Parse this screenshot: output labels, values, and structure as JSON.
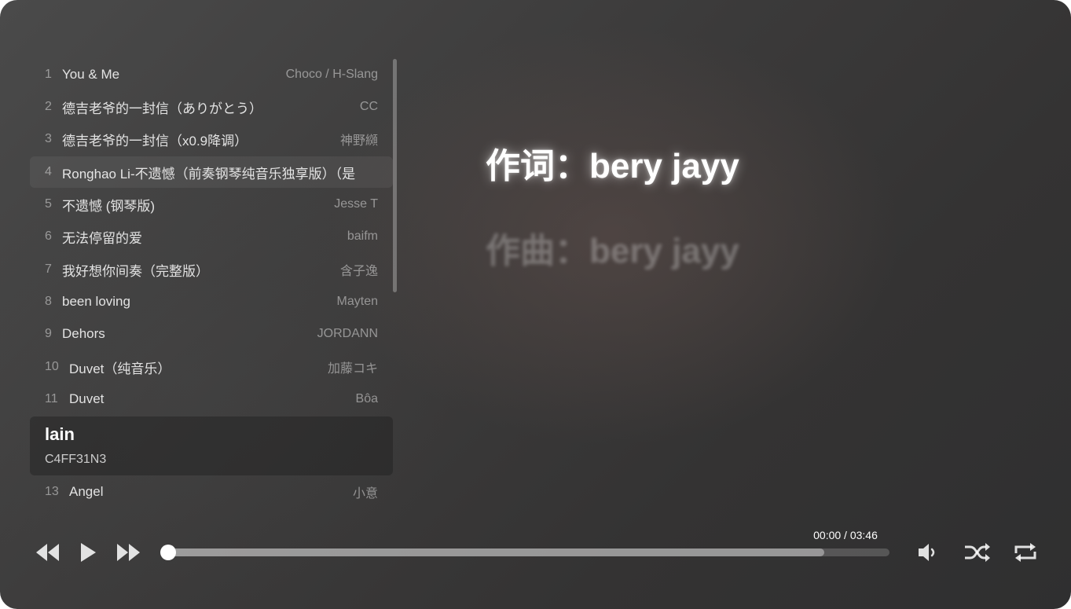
{
  "playlist": {
    "tracks": [
      {
        "index": "1",
        "title": "You & Me",
        "artist": "Choco / H-Slang"
      },
      {
        "index": "2",
        "title": "德吉老爷的一封信（ありがとう）",
        "artist": "CC"
      },
      {
        "index": "3",
        "title": "德吉老爷的一封信（x0.9降调）",
        "artist": "神野纐"
      },
      {
        "index": "4",
        "title": "Ronghao Li-不遗憾（前奏钢琴纯音乐独享版）（是",
        "artist": ""
      },
      {
        "index": "5",
        "title": "不遗憾 (钢琴版)",
        "artist": "Jesse T"
      },
      {
        "index": "6",
        "title": "无法停留的爱",
        "artist": "baifm"
      },
      {
        "index": "7",
        "title": "我好想你间奏（完整版）",
        "artist": "含子逸"
      },
      {
        "index": "8",
        "title": "been loving",
        "artist": "Mayten"
      },
      {
        "index": "9",
        "title": "Dehors",
        "artist": "JORDANN"
      },
      {
        "index": "10",
        "title": "Duvet（纯音乐）",
        "artist": "加藤コキ"
      },
      {
        "index": "11",
        "title": "Duvet",
        "artist": "Bôa"
      }
    ],
    "current": {
      "title": "lain",
      "artist": "C4FF31N3"
    },
    "after": {
      "index": "13",
      "title": "Angel",
      "artist": "小意"
    }
  },
  "lyrics": {
    "current": "作词：bery jayy",
    "next": "作曲：bery jayy"
  },
  "controls": {
    "time": "00:00 / 03:46",
    "progress": 0,
    "buffered": 0.91,
    "icons": [
      "rewind-icon",
      "play-icon",
      "fast-forward-icon",
      "volume-icon",
      "shuffle-icon",
      "repeat-icon"
    ]
  }
}
